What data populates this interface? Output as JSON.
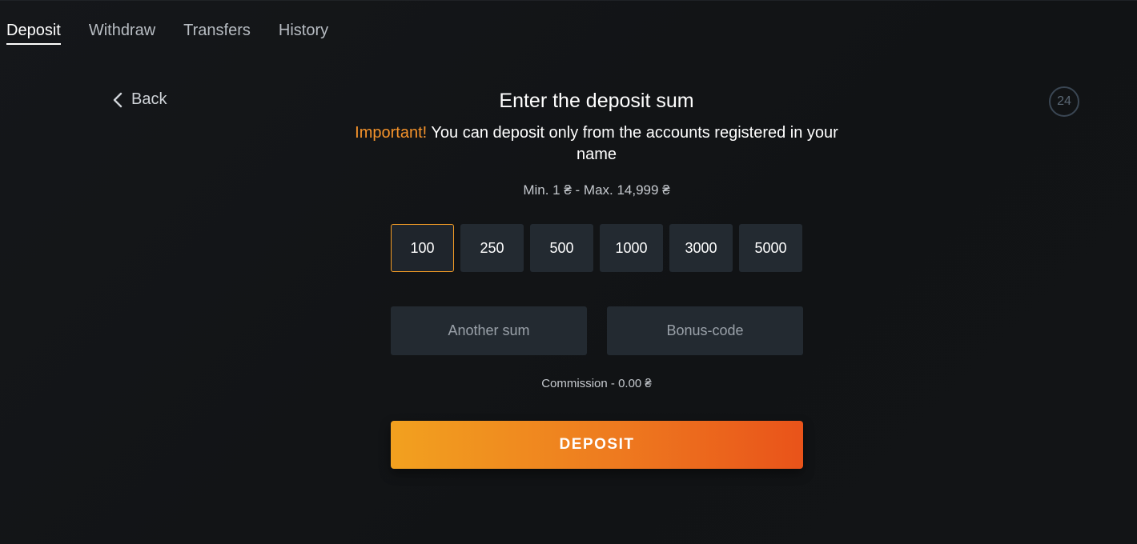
{
  "tabs": [
    {
      "label": "Deposit",
      "active": true
    },
    {
      "label": "Withdraw",
      "active": false
    },
    {
      "label": "Transfers",
      "active": false
    },
    {
      "label": "History",
      "active": false
    }
  ],
  "back": {
    "label": "Back",
    "icon": "chevron-left-icon"
  },
  "support_badge": {
    "label": "24"
  },
  "form": {
    "title": "Enter the deposit sum",
    "notice_highlight": "Important!",
    "notice_text": " You can deposit only from the accounts registered in your name",
    "limits": "Min. 1 ₴ - Max. 14,999 ₴",
    "amounts": [
      "100",
      "250",
      "500",
      "1000",
      "3000",
      "5000"
    ],
    "selected_amount": "100",
    "another_sum_placeholder": "Another sum",
    "bonus_code_placeholder": "Bonus-code",
    "commission": "Commission - 0.00 ₴",
    "deposit_label": "DEPOSIT"
  },
  "colors": {
    "accent": "#f39c25",
    "warning_text": "#f5932b",
    "button_gradient_start": "#f2a11f",
    "button_gradient_end": "#e9531a",
    "panel": "#232a31"
  }
}
